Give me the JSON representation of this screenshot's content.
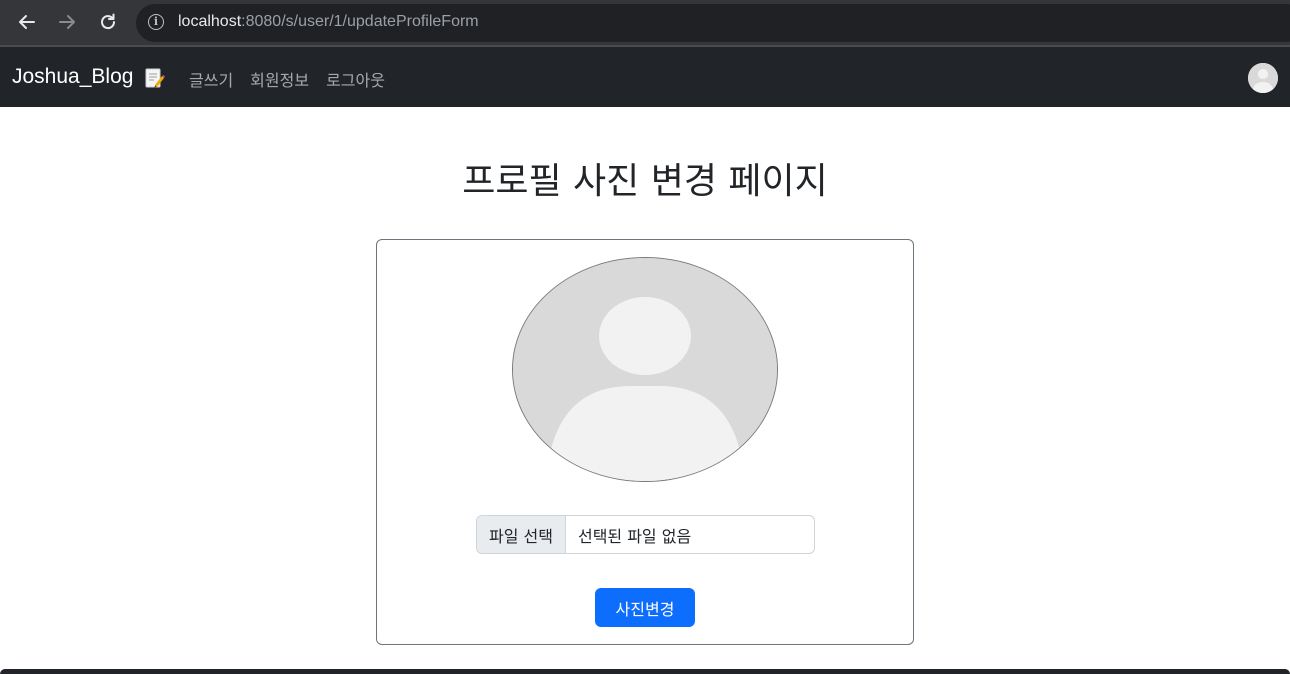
{
  "browser": {
    "url_host": "localhost",
    "url_rest": ":8080/s/user/1/updateProfileForm"
  },
  "navbar": {
    "brand": "Joshua_Blog",
    "links": [
      "글쓰기",
      "회원정보",
      "로그아웃"
    ]
  },
  "main": {
    "title": "프로필 사진 변경 페이지",
    "file_button_label": "파일 선택",
    "file_status": "선택된 파일 없음",
    "submit_label": "사진변경"
  },
  "colors": {
    "navbar_bg": "#212529",
    "primary": "#0d6efd"
  },
  "icons": {
    "brand": "memo-icon",
    "avatar": "default-user-avatar"
  }
}
